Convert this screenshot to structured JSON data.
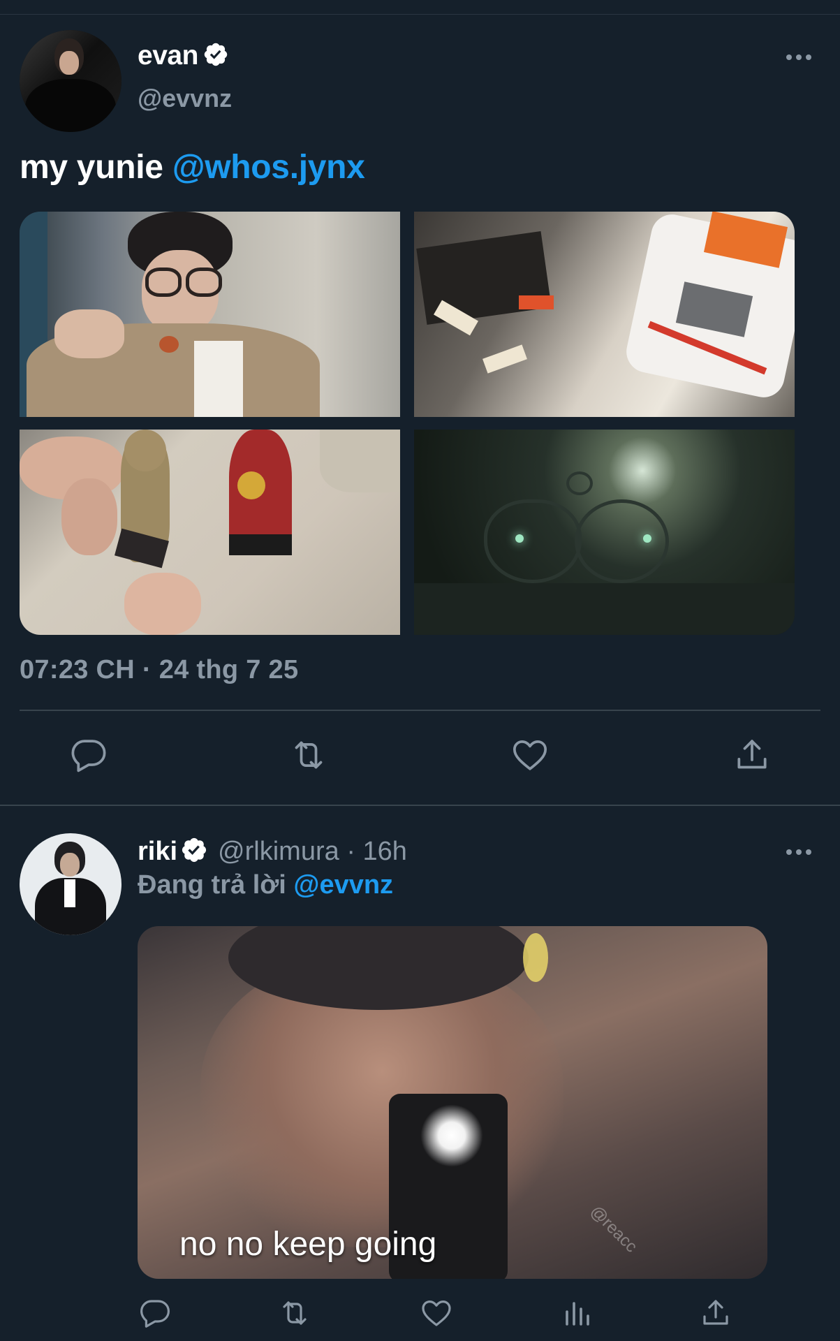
{
  "main_tweet": {
    "author_name": "evan",
    "author_handle": "@evvnz",
    "text": "my yunie ",
    "mention": "@whos.jynx",
    "timestamp": "07:23 CH · 24 thg 7 25",
    "media_count": 4,
    "actions": [
      "reply-icon",
      "retweet-icon",
      "like-icon",
      "share-icon"
    ]
  },
  "reply_tweet": {
    "author_name": "riki",
    "author_handle": "@rlkimura",
    "separator": "·",
    "time": "16h",
    "replying_label": "Đang trả lời ",
    "replying_to": "@evvnz",
    "media_caption": "no no keep going",
    "media_watermark": "@reacc",
    "actions": [
      "reply-icon",
      "retweet-icon",
      "like-icon",
      "analytics-icon",
      "share-icon"
    ]
  },
  "colors": {
    "background": "#15202b",
    "accent": "#1d9bf0",
    "secondary_text": "#8b98a5",
    "divider": "#38444d"
  }
}
